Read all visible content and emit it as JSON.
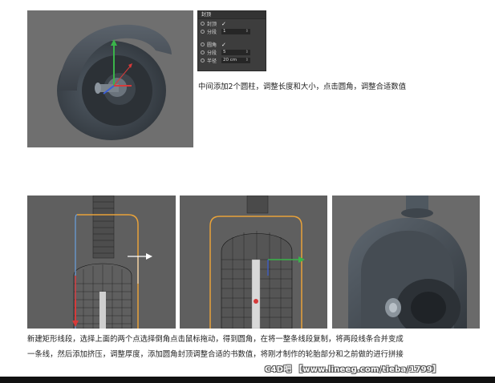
{
  "attr_panel": {
    "header": "封顶",
    "rows": [
      {
        "label": "封顶",
        "value": "✓",
        "type": "check"
      },
      {
        "label": "分段",
        "value": "1",
        "type": "field"
      },
      {
        "label": "圆角",
        "value": "✓",
        "type": "check"
      },
      {
        "label": "分段",
        "value": "5",
        "type": "field"
      },
      {
        "label": "半径",
        "value": "20 cm",
        "type": "field"
      }
    ]
  },
  "captions": {
    "top": "中间添加2个圆柱，调整长度和大小，点击圆角，调整合适数值",
    "bottom_line1": "新建矩形线段，选择上面的两个点选择倒角点击鼠标拖动，得到圆角，在将一整条线段复制，将两段线条合并变成",
    "bottom_line2": "一条线，然后添加挤压，调整厚度，添加圆角封顶调整合适的书数值，将刚才制作的轮胎部分和之前做的进行拼接"
  },
  "watermark": "C4D吧 【www.lineeg.com/tieba/1799】",
  "colors": {
    "viewport_bg": "#6f6f6f",
    "model_gray": "#4a525a",
    "axis_x": "#d63a3a",
    "axis_y": "#3ab34a",
    "axis_z": "#3a5fd6",
    "spline_orange": "#e8a23a"
  }
}
